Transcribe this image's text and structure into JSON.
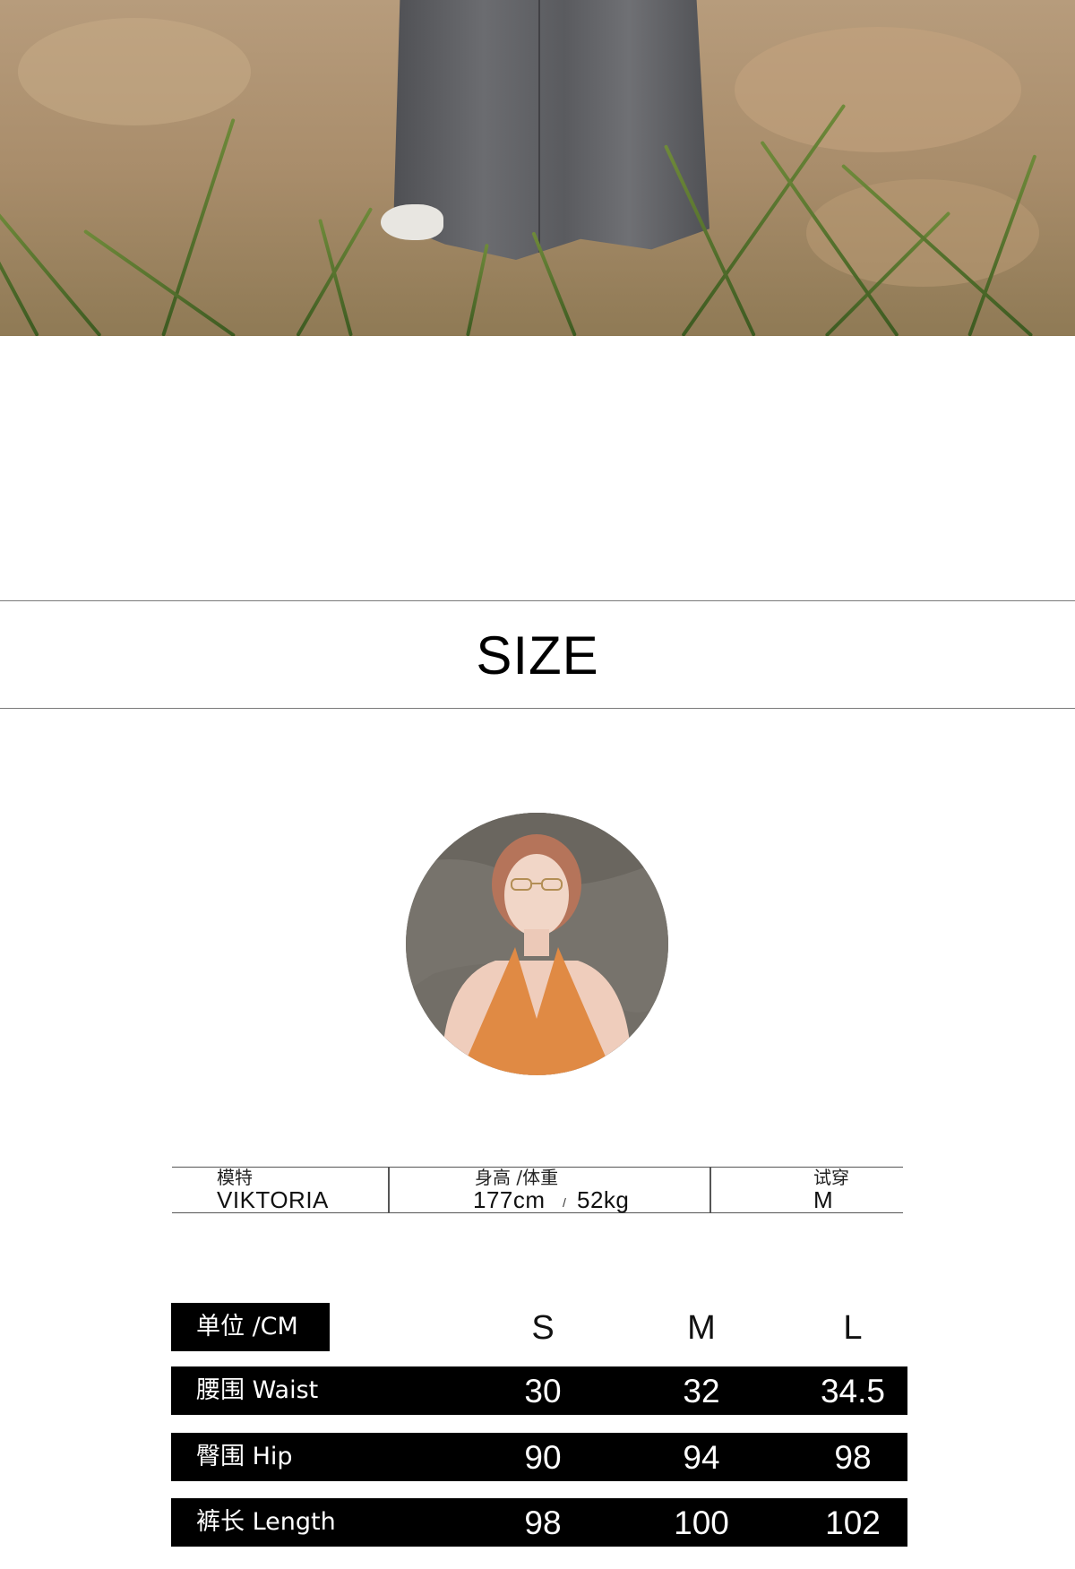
{
  "section_title": "SIZE",
  "model": {
    "name_label": "模特",
    "name": "VIKTORIA",
    "measure_label": "身高 /体重",
    "height": "177cm",
    "separator": "/",
    "weight": "52kg",
    "fit_label": "试穿",
    "fit_size": "M"
  },
  "size_chart": {
    "unit_label": "单位 /CM",
    "sizes": [
      "S",
      "M",
      "L"
    ],
    "rows": [
      {
        "label": "腰围 Waist",
        "values": [
          "30",
          "32",
          "34.5"
        ]
      },
      {
        "label": "臀围 Hip",
        "values": [
          "90",
          "94",
          "98"
        ]
      },
      {
        "label": "裤长 Length",
        "values": [
          "98",
          "100",
          "102"
        ]
      }
    ]
  }
}
